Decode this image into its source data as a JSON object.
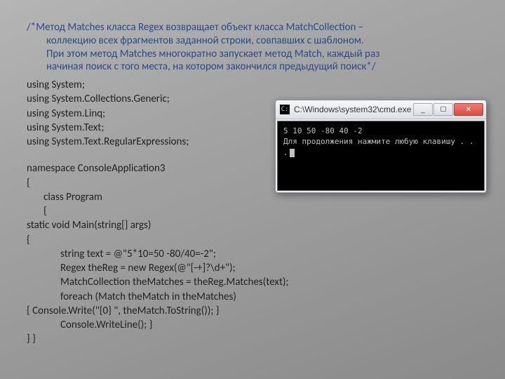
{
  "comment": {
    "first": "/*Метод Matches класса Regex возвращает объект класса MatchCollection –",
    "rest1": "коллекцию всех фрагментов заданной строки, совпавших с шаблоном.",
    "rest2": "При этом метод Matches многократно запускает метод Match, каждый раз",
    "rest3": "начиная поиск с того места, на котором закончился предыдущий поиск*/"
  },
  "code": {
    "u1": "using System;",
    "u2": "using System.Collections.Generic;",
    "u3": "using System.Linq;",
    "u4": "using System.Text;",
    "u5": "using System.Text.RegularExpressions;",
    "ns": "namespace ConsoleApplication3",
    "ob": "{",
    "cp": "class Program",
    "ob2": "{",
    "main": "static void Main(string[] args)",
    "ob3": "{",
    "l1": "string text = @\"5*10=50 -80/40=-2\";",
    "l2": "Regex theReg = new Regex(@\"[-+]?\\d+\");",
    "l3": "MatchCollection theMatches = theReg.Matches(text);",
    "l4": "foreach (Match theMatch in theMatches)",
    "l5": "{       Console.Write(\"{0} \", theMatch.ToString());        }",
    "l6": "Console.WriteLine();   }",
    "cb": "}    }"
  },
  "cmd": {
    "title": "C:\\Windows\\system32\\cmd.exe",
    "line1": "5 10 50 -80 40 -2",
    "line2": "Для продолжения нажмите любую клавишу . . ."
  },
  "buttons": {
    "min": "_",
    "max": "☐",
    "close": "✕"
  }
}
